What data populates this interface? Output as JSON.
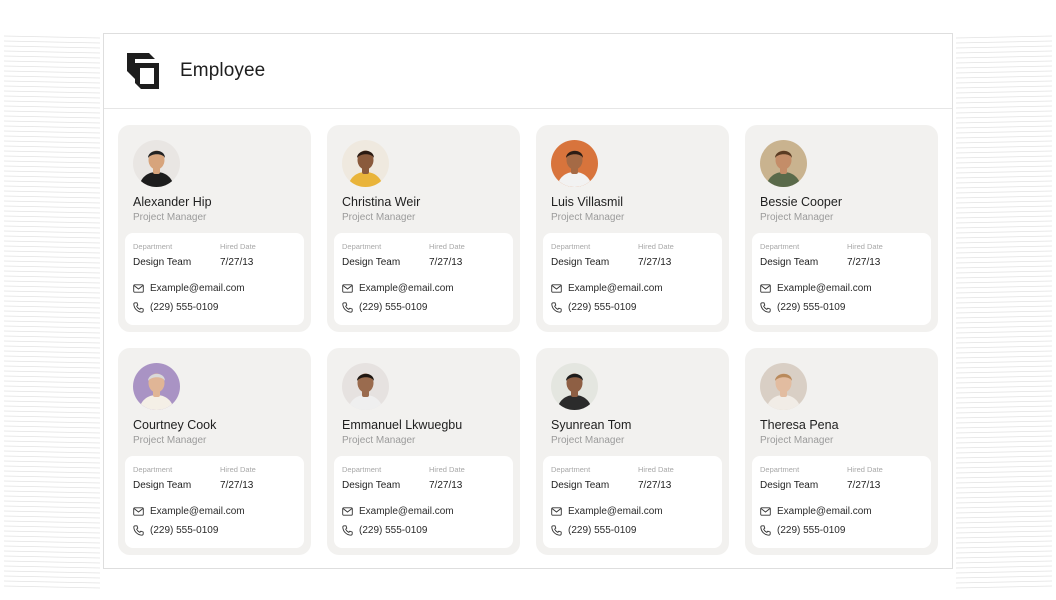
{
  "app": {
    "title": "Employee"
  },
  "labels": {
    "department": "Department",
    "hired_date": "Hired Date"
  },
  "employees": [
    {
      "name": "Alexander Hip",
      "role": "Project Manager",
      "department": "Design Team",
      "hired": "7/27/13",
      "email": "Example@email.com",
      "phone": "(229) 555-0109",
      "bg": "#e9e6e3",
      "skin": "#d7a47c",
      "hair": "#222222",
      "shirt": "#1d1d1d"
    },
    {
      "name": "Christina Weir",
      "role": "Project Manager",
      "department": "Design Team",
      "hired": "7/27/13",
      "email": "Example@email.com",
      "phone": "(229) 555-0109",
      "bg": "#efe9df",
      "skin": "#8a5a3c",
      "hair": "#2a1a12",
      "shirt": "#e9b43a"
    },
    {
      "name": "Luis Villasmil",
      "role": "Project Manager",
      "department": "Design Team",
      "hired": "7/27/13",
      "email": "Example@email.com",
      "phone": "(229) 555-0109",
      "bg": "#d8743c",
      "skin": "#a56a45",
      "hair": "#2b1c14",
      "shirt": "#f2f2f2"
    },
    {
      "name": "Bessie Cooper",
      "role": "Project Manager",
      "department": "Design Team",
      "hired": "7/27/13",
      "email": "Example@email.com",
      "phone": "(229) 555-0109",
      "bg": "#c9b38f",
      "skin": "#c48d68",
      "hair": "#5a3b22",
      "shirt": "#5a6a4a"
    },
    {
      "name": "Courtney Cook",
      "role": "Project Manager",
      "department": "Design Team",
      "hired": "7/27/13",
      "email": "Example@email.com",
      "phone": "(229) 555-0109",
      "bg": "#a993c4",
      "skin": "#e0b596",
      "hair": "#d9d9d9",
      "shirt": "#f4efe6"
    },
    {
      "name": "Emmanuel Lkwuegbu",
      "role": "Project Manager",
      "department": "Design Team",
      "hired": "7/27/13",
      "email": "Example@email.com",
      "phone": "(229) 555-0109",
      "bg": "#e6e2e0",
      "skin": "#9a6b4e",
      "hair": "#1f1712",
      "shirt": "#efefef"
    },
    {
      "name": "Syunrean Tom",
      "role": "Project Manager",
      "department": "Design Team",
      "hired": "7/27/13",
      "email": "Example@email.com",
      "phone": "(229) 555-0109",
      "bg": "#e4e6e0",
      "skin": "#8e5f44",
      "hair": "#1c1c1c",
      "shirt": "#2b2b2b"
    },
    {
      "name": "Theresa Pena",
      "role": "Project Manager",
      "department": "Design Team",
      "hired": "7/27/13",
      "email": "Example@email.com",
      "phone": "(229) 555-0109",
      "bg": "#d9cfc5",
      "skin": "#e2bca0",
      "hair": "#b98a5c",
      "shirt": "#f1ece6"
    }
  ]
}
